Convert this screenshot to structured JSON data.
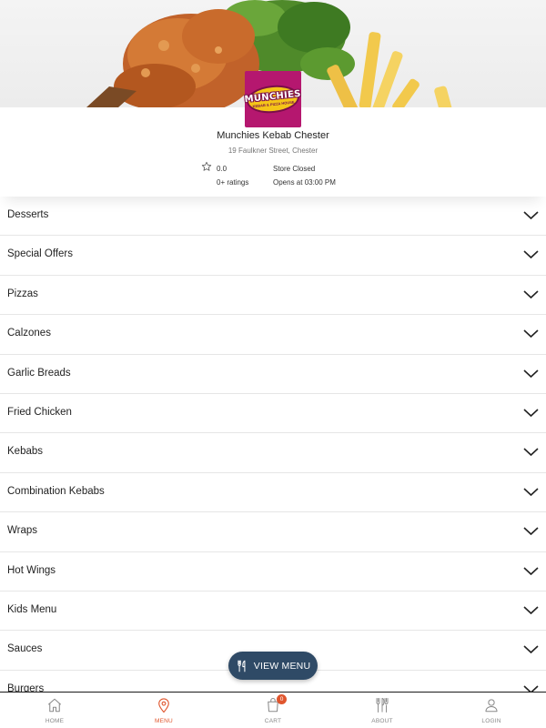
{
  "store": {
    "name": "Munchies Kebab Chester",
    "address": "19 Faulkner Street, Chester",
    "rating": "0.0",
    "rating_count": "0+ ratings",
    "status": "Store Closed",
    "opens_at": "Opens at 03:00 PM",
    "logo_text": "MUNCHIES",
    "logo_subtext": "KEBAB & PIZZA HOUSE"
  },
  "categories": [
    {
      "label": "Desserts"
    },
    {
      "label": "Special Offers"
    },
    {
      "label": "Pizzas"
    },
    {
      "label": "Calzones"
    },
    {
      "label": "Garlic Breads"
    },
    {
      "label": "Fried Chicken"
    },
    {
      "label": "Kebabs"
    },
    {
      "label": "Combination Kebabs"
    },
    {
      "label": "Wraps"
    },
    {
      "label": "Hot Wings"
    },
    {
      "label": "Kids Menu"
    },
    {
      "label": "Sauces"
    },
    {
      "label": "Burgers"
    }
  ],
  "view_menu": {
    "label": "VIEW MENU",
    "icon": "cutlery-icon"
  },
  "nav": {
    "home": {
      "label": "HOME",
      "icon": "home-icon"
    },
    "menu": {
      "label": "MENU",
      "icon": "location-pin-icon"
    },
    "cart": {
      "label": "CART",
      "icon": "shopping-bag-icon",
      "badge": "0"
    },
    "about": {
      "label": "ABOUT",
      "icon": "cutlery-icon"
    },
    "login": {
      "label": "LOGIN",
      "icon": "user-icon"
    }
  },
  "colors": {
    "accent": "#e0562e",
    "brand": "#b5176f",
    "button": "#2f4a66"
  }
}
